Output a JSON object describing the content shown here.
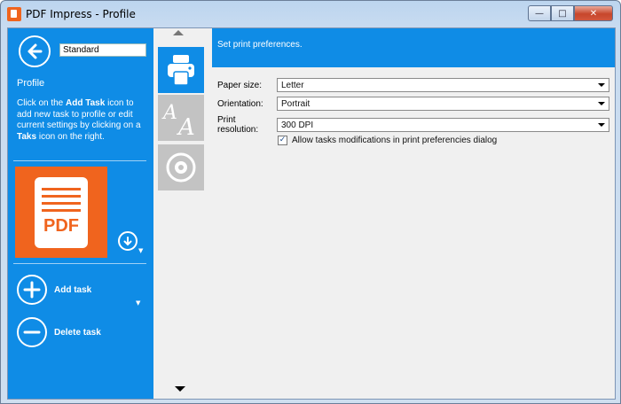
{
  "window": {
    "title": "PDF Impress - Profile"
  },
  "titlebar_buttons": {
    "minimize": "—",
    "maximize": "□",
    "close": "✕"
  },
  "sidebar": {
    "profile_name": "Standard",
    "heading": "Profile",
    "help": {
      "p1": "Click on the ",
      "b1": "Add Task",
      "p2": " icon to add new task to profile or edit current settings by clicking on a ",
      "b2": "Taks",
      "p3": " icon on the right."
    },
    "pdf_label": "PDF",
    "add_task": "Add task",
    "delete_task": "Delete task"
  },
  "content": {
    "banner": "Set print preferences.",
    "paper_size": {
      "label": "Paper size:",
      "value": "Letter"
    },
    "orientation": {
      "label": "Orientation:",
      "value": "Portrait"
    },
    "print_resolution": {
      "label": "Print resolution:",
      "value": "300 DPI"
    },
    "allow_tasks": {
      "label": "Allow tasks modifications in print preferencies dialog",
      "checked": true,
      "mark": "✓"
    }
  },
  "colors": {
    "accent": "#0f8ce6",
    "pdf_orange": "#f0641e"
  }
}
